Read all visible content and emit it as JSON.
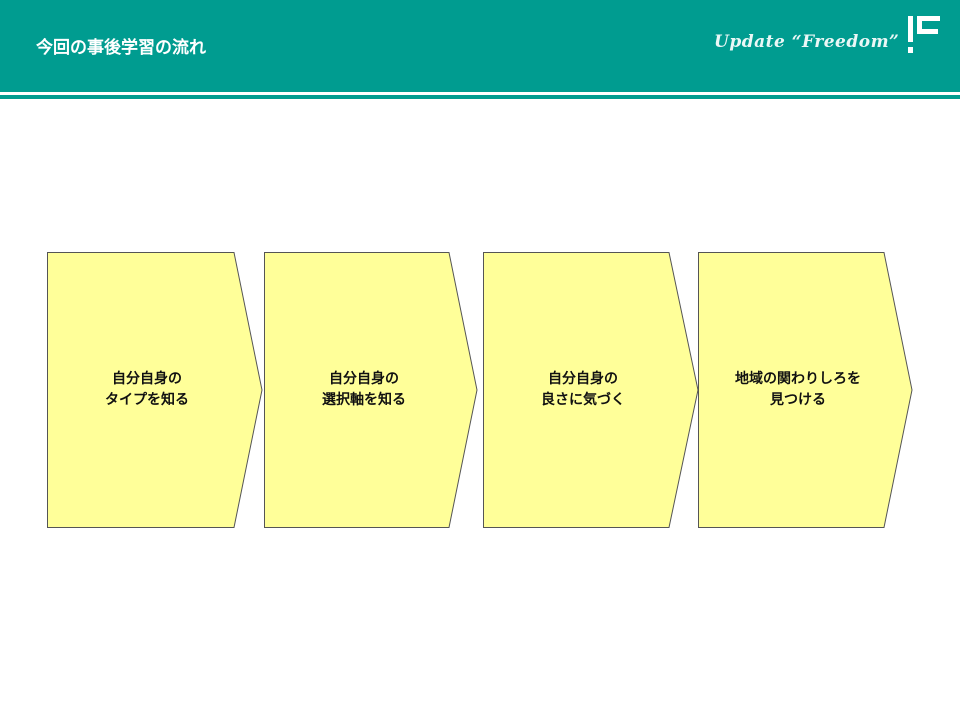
{
  "header": {
    "title": "今回の事後学習の流れ",
    "tagline": "Update “Freedom”",
    "logo_icon": "brand-logo-icon"
  },
  "colors": {
    "header": "#009c90",
    "step_fill": "#ffff99",
    "step_stroke": "#555555",
    "text": "#111111"
  },
  "steps": [
    {
      "line1": "自分自身の",
      "line2": "タイプを知る"
    },
    {
      "line1": "自分自身の",
      "line2": "選択軸を知る"
    },
    {
      "line1": "自分自身の",
      "line2": "良さに気づく"
    },
    {
      "line1": "地域の関わりしろを",
      "line2": "見つける"
    }
  ]
}
